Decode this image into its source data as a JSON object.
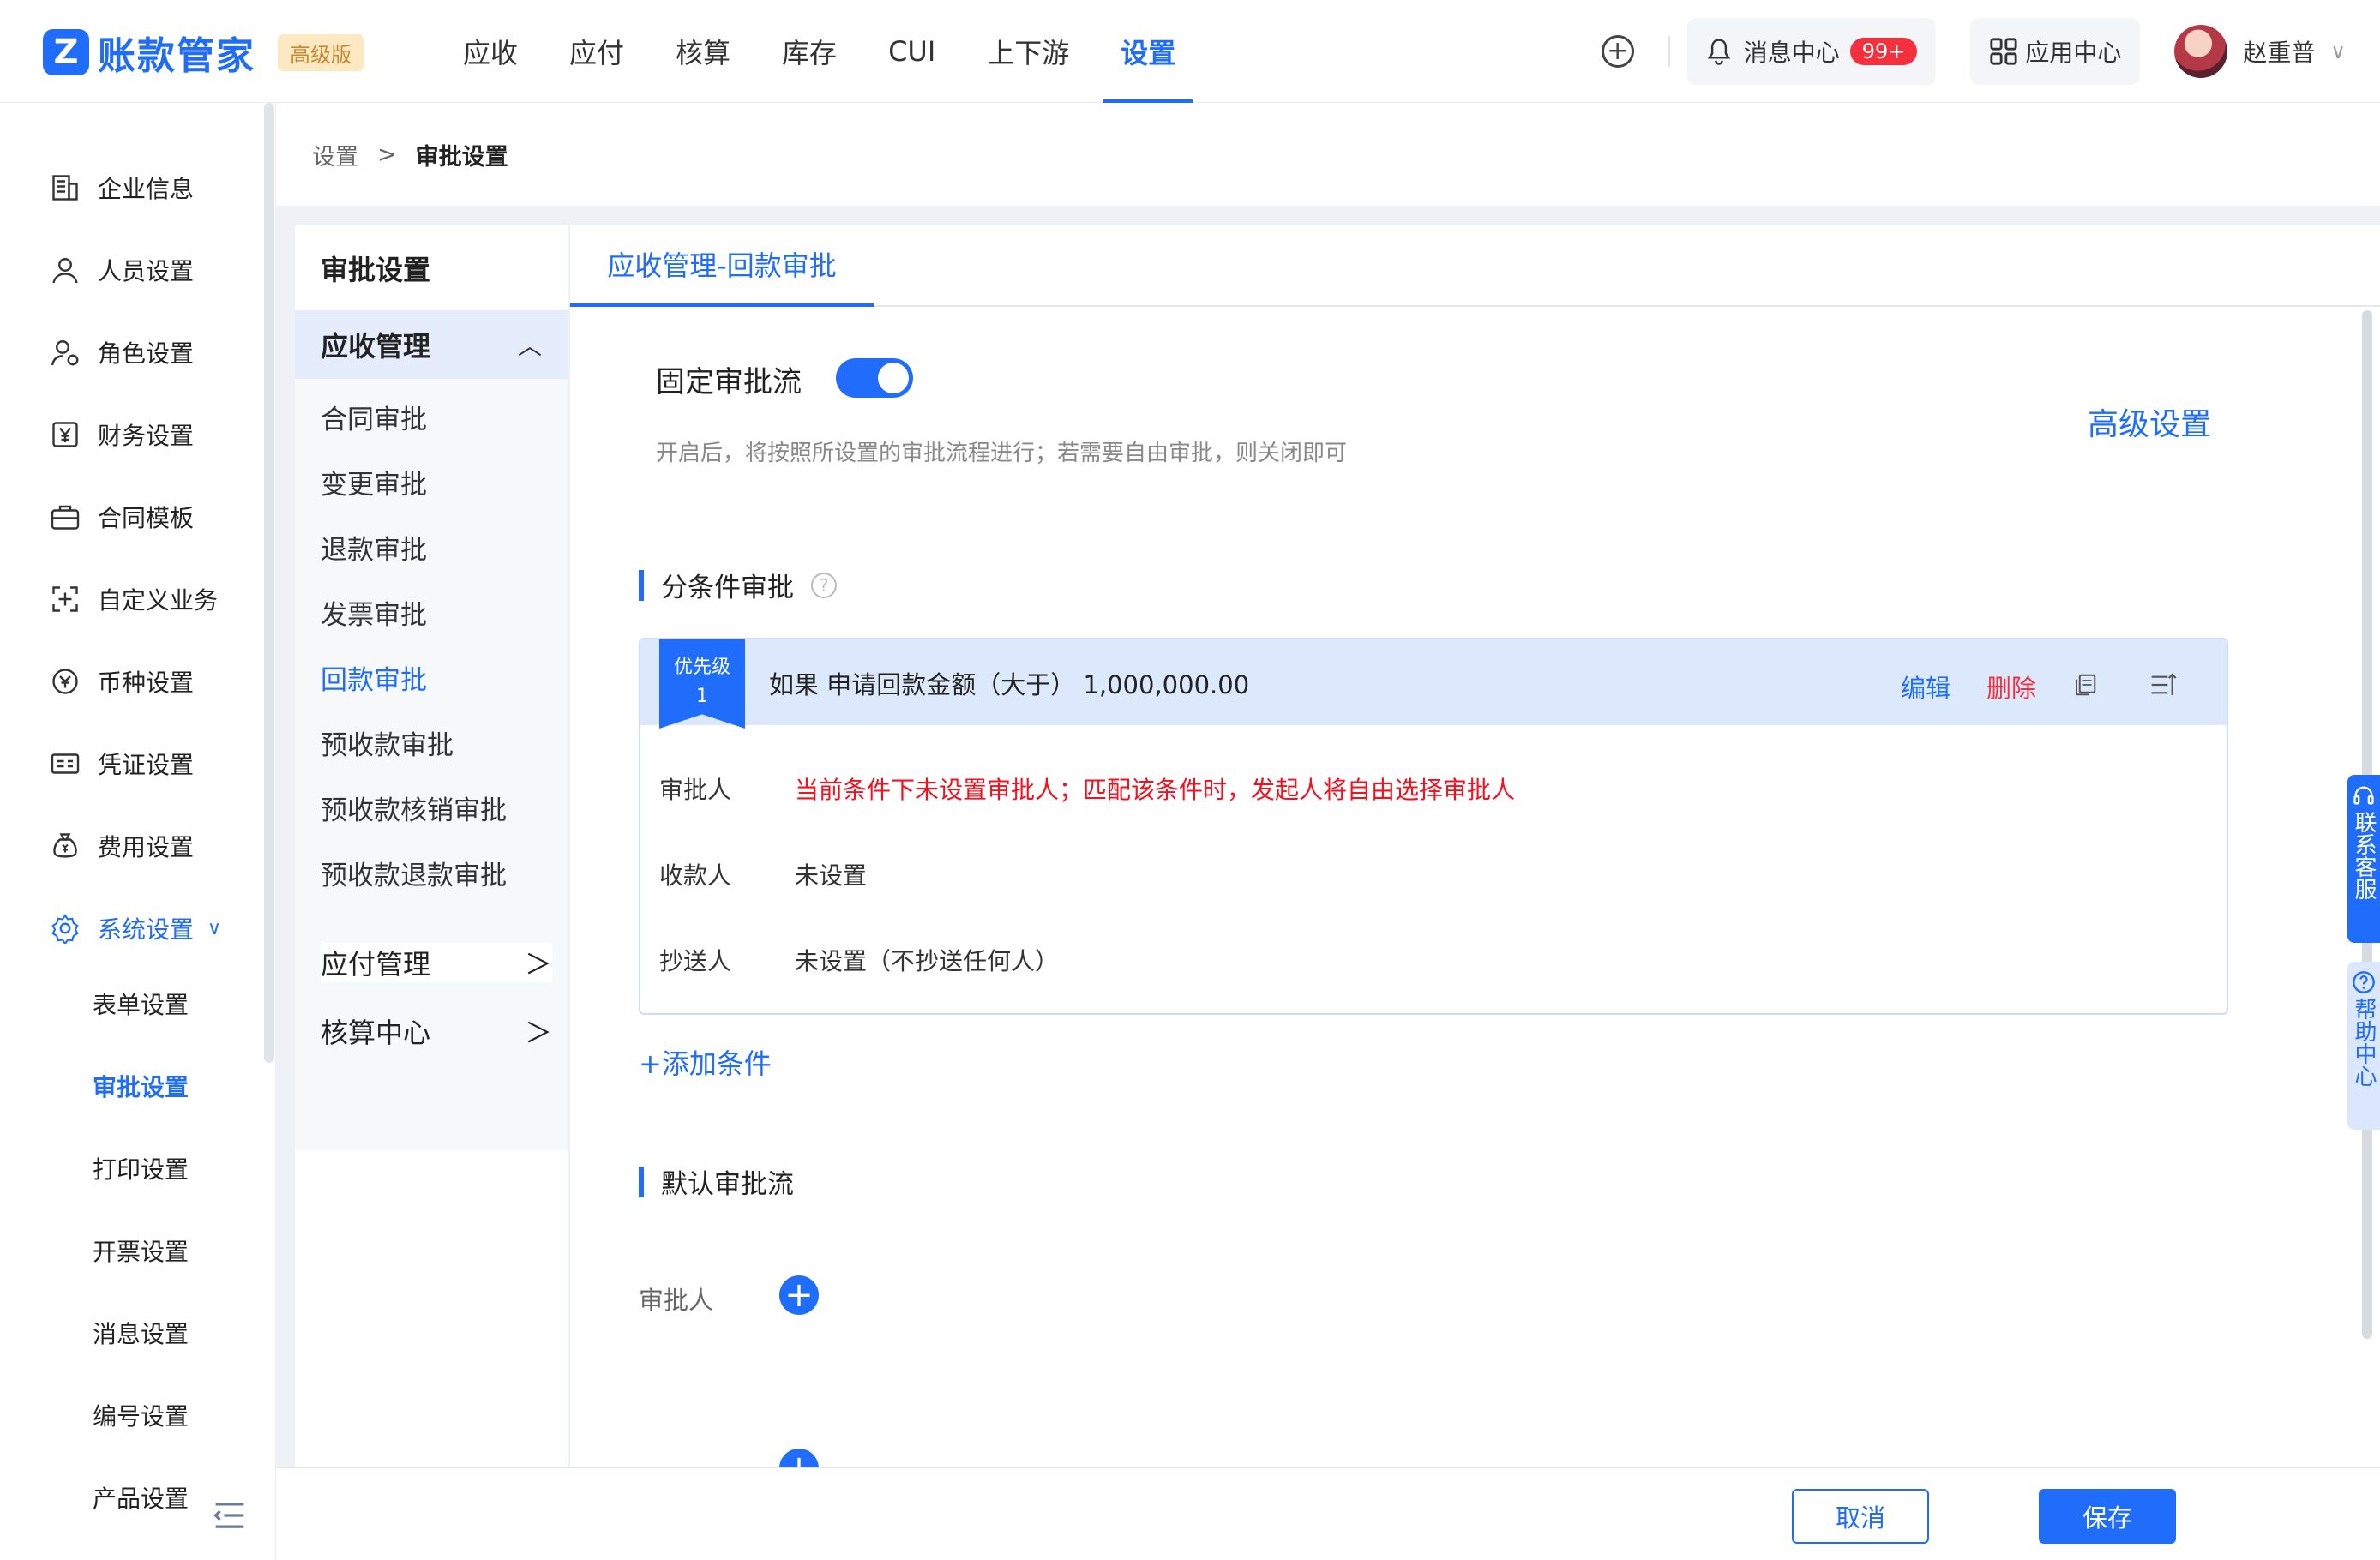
{
  "app": {
    "logo_mark": "Z",
    "name": "账款管家",
    "edition": "高级版"
  },
  "topnav": {
    "items": [
      {
        "label": "应收"
      },
      {
        "label": "应付"
      },
      {
        "label": "核算"
      },
      {
        "label": "库存"
      },
      {
        "label": "CUI"
      },
      {
        "label": "上下游"
      },
      {
        "label": "设置"
      }
    ],
    "active_index": 6,
    "add_icon": "plus-circle-icon",
    "messages": {
      "label": "消息中心",
      "badge": "99+",
      "icon": "bell-icon"
    },
    "apps": {
      "label": "应用中心",
      "icon": "grid-icon"
    },
    "user": {
      "name": "赵重普"
    }
  },
  "sidebar": {
    "items": [
      {
        "label": "企业信息",
        "icon": "building-icon"
      },
      {
        "label": "人员设置",
        "icon": "person-icon"
      },
      {
        "label": "角色设置",
        "icon": "role-icon"
      },
      {
        "label": "财务设置",
        "icon": "yen-icon"
      },
      {
        "label": "合同模板",
        "icon": "briefcase-icon"
      },
      {
        "label": "自定义业务",
        "icon": "custom-icon"
      },
      {
        "label": "币种设置",
        "icon": "currency-icon"
      },
      {
        "label": "凭证设置",
        "icon": "voucher-icon"
      },
      {
        "label": "费用设置",
        "icon": "moneybag-icon"
      },
      {
        "label": "系统设置",
        "icon": "system-gear-icon"
      }
    ],
    "system_children": [
      {
        "label": "表单设置"
      },
      {
        "label": "审批设置"
      },
      {
        "label": "打印设置"
      },
      {
        "label": "开票设置"
      },
      {
        "label": "消息设置"
      },
      {
        "label": "编号设置"
      },
      {
        "label": "产品设置"
      }
    ],
    "active_child": "审批设置"
  },
  "breadcrumb": {
    "parent": "设置",
    "separator": ">",
    "current": "审批设置"
  },
  "subnav": {
    "title": "审批设置",
    "group_open": "应收管理",
    "children": [
      {
        "label": "合同审批"
      },
      {
        "label": "变更审批"
      },
      {
        "label": "退款审批"
      },
      {
        "label": "发票审批"
      },
      {
        "label": "回款审批"
      },
      {
        "label": "预收款审批"
      },
      {
        "label": "预收款核销审批"
      },
      {
        "label": "预收款退款审批"
      }
    ],
    "active_child": "回款审批",
    "closed_groups": [
      {
        "label": "应付管理"
      },
      {
        "label": "核算中心"
      }
    ]
  },
  "content": {
    "tab": "应收管理-回款审批",
    "fixed_flow": {
      "label": "固定审批流",
      "enabled": true,
      "description": "开启后，将按照所设置的审批流程进行；若需要自由审批，则关闭即可"
    },
    "advanced_link": "高级设置",
    "conditional": {
      "title": "分条件审批",
      "card": {
        "priority_label": "优先级",
        "priority_value": "1",
        "condition": "如果 申请回款金额（大于） 1,000,000.00",
        "edit": "编辑",
        "delete": "删除",
        "rows": [
          {
            "label": "审批人",
            "value": "当前条件下未设置审批人；匹配该条件时，发起人将自由选择审批人"
          },
          {
            "label": "收款人",
            "value": "未设置"
          },
          {
            "label": "抄送人",
            "value": "未设置（不抄送任何人）"
          }
        ]
      },
      "add_condition": "+添加条件"
    },
    "default_flow": {
      "title": "默认审批流",
      "approver_label": "审批人"
    }
  },
  "footer": {
    "cancel": "取消",
    "save": "保存"
  },
  "float_tabs": {
    "service": "联系客服",
    "help": "帮助中心"
  },
  "colors": {
    "primary": "#1f6dfa",
    "danger": "#f5303e",
    "warn_text": "#f5101f"
  }
}
